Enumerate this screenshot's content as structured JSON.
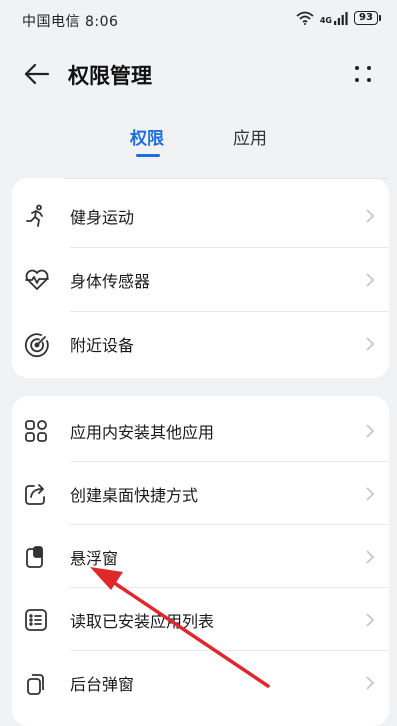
{
  "status_bar": {
    "carrier_time": "中国电信 8:06",
    "network": "4G",
    "battery": "93"
  },
  "header": {
    "title": "权限管理"
  },
  "tabs": [
    {
      "label": "权限",
      "active": true
    },
    {
      "label": "应用",
      "active": false
    }
  ],
  "group1": [
    {
      "label": "健身运动",
      "icon": "running-person-icon"
    },
    {
      "label": "身体传感器",
      "icon": "heart-pulse-icon"
    },
    {
      "label": "附近设备",
      "icon": "radar-target-icon"
    }
  ],
  "group2": [
    {
      "label": "应用内安装其他应用",
      "icon": "app-grid-icon"
    },
    {
      "label": "创建桌面快捷方式",
      "icon": "share-shortcut-icon"
    },
    {
      "label": "悬浮窗",
      "icon": "floating-window-icon"
    },
    {
      "label": "读取已安装应用列表",
      "icon": "list-icon"
    },
    {
      "label": "后台弹窗",
      "icon": "background-popup-icon"
    }
  ],
  "colors": {
    "accent": "#1f6ee0",
    "annotation_arrow": "#e0282a",
    "background": "#f1f2f4"
  }
}
